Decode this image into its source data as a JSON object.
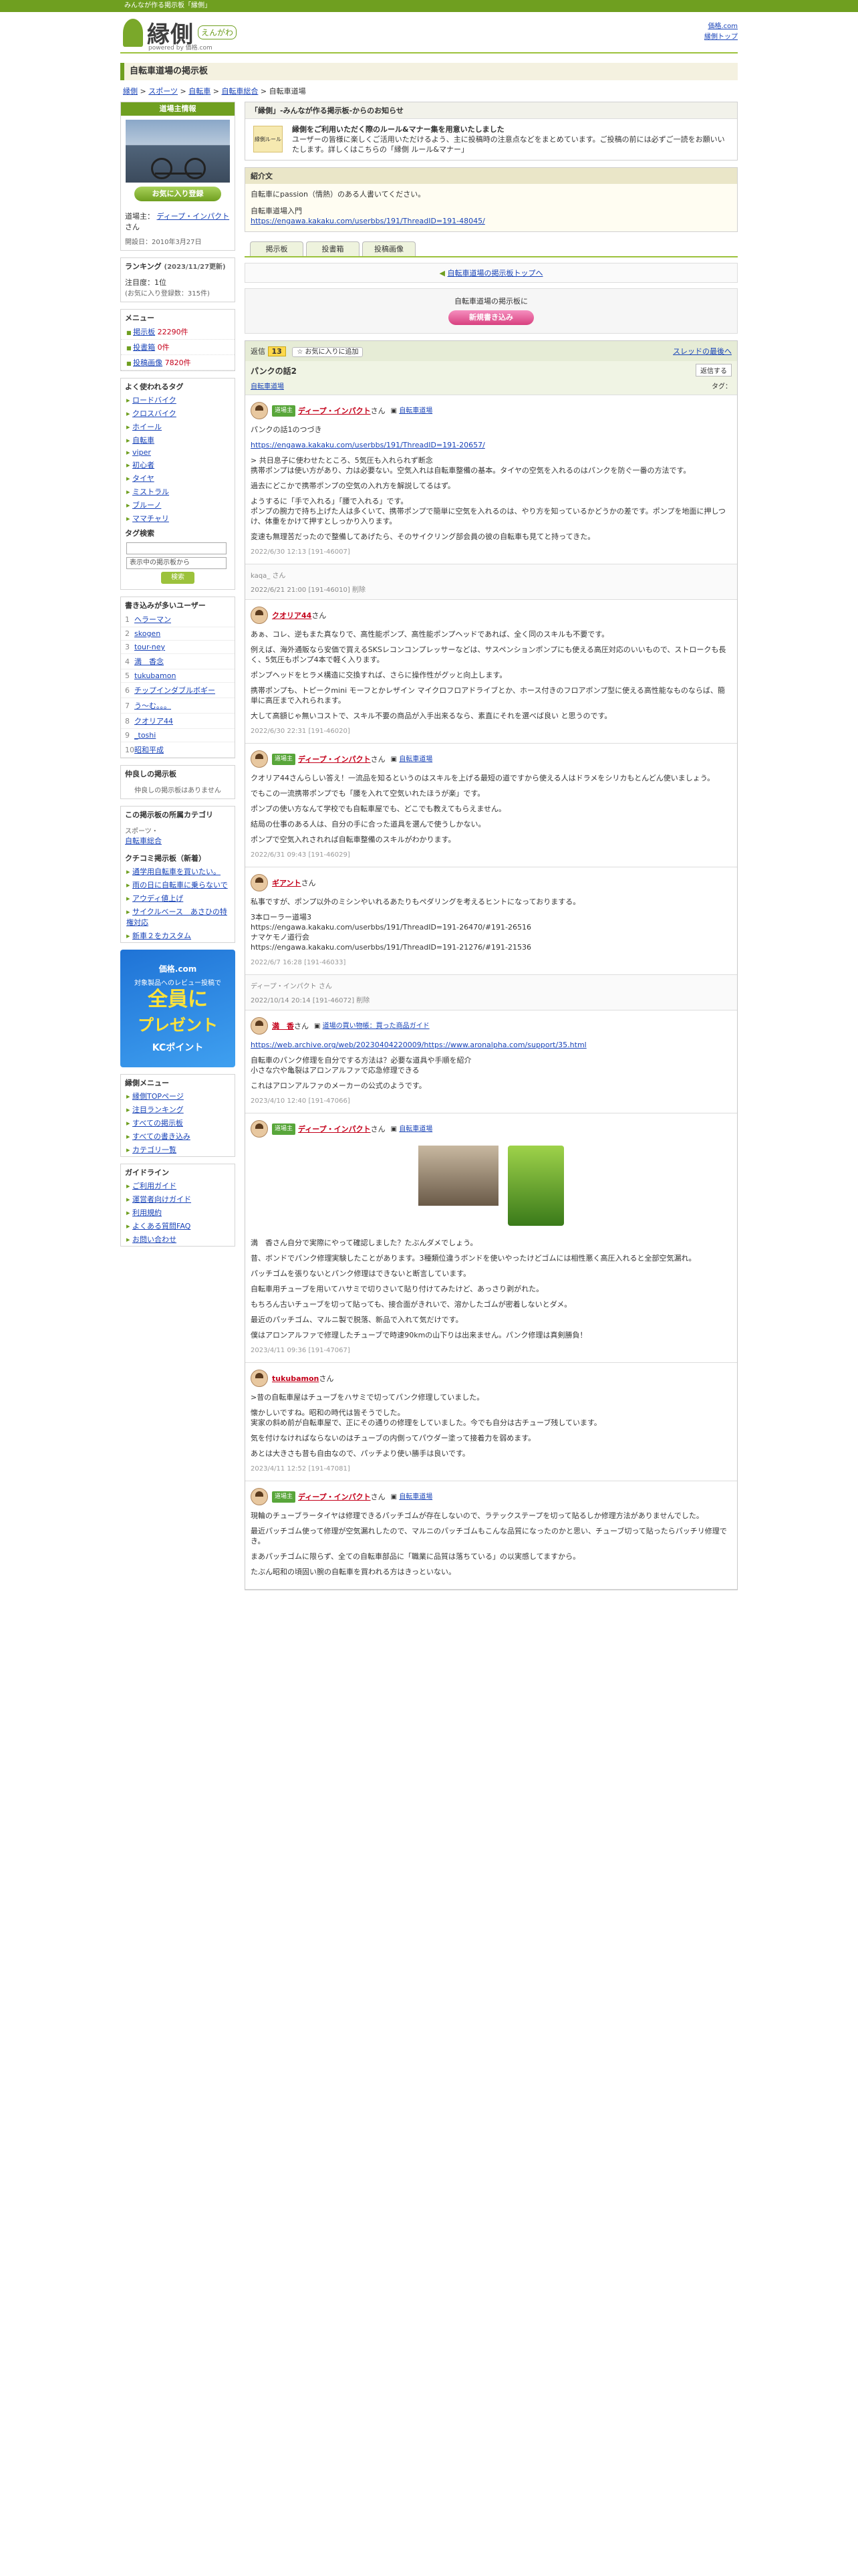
{
  "topbar": {
    "text": "みんなが作る掲示板「縁側」"
  },
  "header": {
    "logo_text": "縁側",
    "logo_reading": "えんがわ",
    "powered_by": "powered by 価格.com",
    "right_links": [
      "価格.com",
      "縁側トップ"
    ]
  },
  "page_title": "自転車道場の掲示板",
  "breadcrumb": [
    "縁側",
    "スポーツ",
    "自転車",
    "自転車総合",
    "自転車道場"
  ],
  "sidebar": {
    "profile_head": "道場主情報",
    "owner_label": "道場主：",
    "owner_name": "ディープ・インパクト",
    "owner_suffix": "さん",
    "fav_button": "お気に入り登録",
    "opened": "開設日：2010年3月27日",
    "ranking_label": "ランキング",
    "ranking_date": "(2023/11/27更新)",
    "popularity": "注目度：1位",
    "popularity_note": "(お気に入り登録数：315件)",
    "menu_head": "メニュー",
    "menu_items": [
      {
        "label": "掲示板",
        "count": "22290件"
      },
      {
        "label": "投書箱",
        "count": "0件"
      },
      {
        "label": "投稿画像",
        "count": "7820件"
      }
    ],
    "tags_head": "よく使われるタグ",
    "tags": [
      "ロードバイク",
      "クロスバイク",
      "ホイール",
      "自転車",
      "viper",
      "初心者",
      "タイヤ",
      "ミストラル",
      "ブルーノ",
      "ママチャリ"
    ],
    "tag_search_head": "タグ検索",
    "tag_select": "表示中の掲示板から",
    "tag_search_button": "検索",
    "writers_head": "書き込みが多いユーザー",
    "writers": [
      "ヘラーマン",
      "skogen",
      "tour-ney",
      "満　香念",
      "tukubamon",
      "チップインダブルボギー",
      "う～む。。。",
      "クオリア44",
      "_toshi",
      "昭和平成"
    ],
    "related_head": "仲良しの掲示板",
    "related_empty": "仲良しの掲示板はありません",
    "category_head": "この掲示板の所属カテゴリ",
    "category_parent": "スポーツ・",
    "category_name": "自転車総合",
    "kuchikomi_head": "クチコミ掲示板（新着）",
    "kuchikomi": [
      "通学用自転車を買いたい。",
      "雨の日に自転車に乗らないで",
      "アウディ値上げ",
      "サイクルベース　あさひの特権対応",
      "新車２をカスタム"
    ],
    "banner": {
      "line1": "価格.com",
      "line2": "対象製品へのレビュー投稿で",
      "big": "全員に",
      "big2": "プレゼント",
      "line3": "KCポイント"
    },
    "engawa_menu_head": "縁側メニュー",
    "engawa_menu": [
      "縁側TOPページ",
      "注目ランキング",
      "すべての掲示板",
      "すべての書き込み",
      "カテゴリ一覧"
    ],
    "guide_head": "ガイドライン",
    "guide": [
      "ご利用ガイド",
      "運営者向けガイド",
      "利用規約",
      "よくある質問FAQ",
      "お問い合わせ"
    ]
  },
  "notice": {
    "head": "「縁側」-みんなが作る掲示板-からのお知らせ",
    "icon": "縁側ルール",
    "bold": "縁側をご利用いただく際のルール&マナー集を用意いたしました",
    "body": "ユーザーの皆様に楽しくご活用いただけるよう、主に投稿時の注意点などをまとめています。ご投稿の前には必ずご一読をお願いいたします。詳しくはこちらの「縁側 ルール&マナー」"
  },
  "intro": {
    "head": "紹介文",
    "line1": "自転車にpassion（情熱）のある人書いてください。",
    "line2": "自転車道場入門",
    "link": "https://engawa.kakaku.com/userbbs/191/ThreadID=191-48045/"
  },
  "tabs": [
    "掲示板",
    "投書箱",
    "投稿画像"
  ],
  "board_top_link": "自転車道場の掲示板トップへ",
  "newpost": {
    "label": "自転車道場の掲示板に",
    "button": "新規書き込み"
  },
  "thread": {
    "count_label": "返信",
    "count": "13",
    "fav": "お気に入りに追加",
    "latest": "スレッドの最後へ",
    "title": "パンクの話2",
    "vote": "返信する",
    "category": "自転車道場",
    "tag_label": "タグ："
  },
  "posts": [
    {
      "badge": "道場主",
      "user": "ディープ・インパクト",
      "suffix": "さん",
      "cat": "自転車道場",
      "paras": [
        "パンクの話1のつづき",
        "https://engawa.kakaku.com/userbbs/191/ThreadID=191-20657/",
        "> 共日息子に使わせたところ、5気圧も入れられず断念\n携帯ポンプは使い方があり、力は必要ない。空気入れは自転車整備の基本。タイヤの空気を入れるのはパンクを防ぐ一番の方法です。",
        "過去にどこかで携帯ポンプの空気の入れ方を解説してるはず。",
        "ようするに「手で入れる」「腰で入れる」です。\nポンプの腕力で持ち上げた人は多くいて、携帯ポンプで簡単に空気を入れるのは、やり方を知っているかどうかの差です。ポンプを地面に押しつけ、体重をかけて押すとしっかり入ります。",
        "変速も無理苦だったので整備してあげたら、そのサイクリング部会員の彼の自転車も見てと持ってきた。"
      ],
      "meta": "2022/6/30 12:13 [191-46007]"
    },
    {
      "anon": "kaqa_ さん",
      "meta": "2022/6/21 21:00 [191-46010] 削除"
    },
    {
      "badge": "",
      "user": "クオリア44",
      "suffix": "さん",
      "cat": "",
      "paras": [
        "あぁ、コレ、逆もまた真なりで、高性能ポンプ、高性能ポンプヘッドであれば、全く同のスキルも不要です。",
        "例えば、海外通販なら安価で買えるSKSレコンコンプレッサーなどは、サスペンションポンプにも使える高圧対応のいいもので、ストロークも長く、5気圧もポンプ4本で軽く入ります。",
        "ポンプヘッドをヒラメ構造に交換すれば、さらに操作性がグッと向上します。",
        "携帯ポンプも、トピークmini モーフとかレザイン マイクロフロアドライブとか、ホース付きのフロアポンプ型に使える高性能なものならば、簡単に高圧まで入れられます。",
        "大して高額じゃ無いコストで、スキル不要の商品が入手出来るなら、素直にそれを選べば良い と思うのです。"
      ],
      "meta": "2022/6/30 22:31 [191-46020]"
    },
    {
      "badge": "道場主",
      "user": "ディープ・インパクト",
      "suffix": "さん",
      "cat": "自転車道場",
      "paras": [
        "クオリア44さんらしい答え！一流品を知るというのはスキルを上げる最短の道ですから使える人はドラメをシリカもとんどん使いましょう。",
        "でもこの一流携帯ポンプでも「腰を入れて空気いれたほうが楽」です。",
        "ポンプの使い方なんて学校でも自転車屋でも、どこでも教えてもらえません。",
        "結局の仕事のある人は、自分の手に合った道具を選んで使うしかない。",
        "ポンプで空気入れされれば自転車整備のスキルがわかります。"
      ],
      "meta": "2022/6/31 09:43 [191-46029]"
    },
    {
      "badge": "",
      "user": "ギアント",
      "suffix": "さん",
      "cat": "",
      "paras": [
        "私事ですが、ポンプ以外のミシンやいれるあたりもペダリングを考えるヒントになっておりまする。",
        "3本ローラー道場3\nhttps://engawa.kakaku.com/userbbs/191/ThreadID=191-26470/#191-26516\nナマケモノ道行会\nhttps://engawa.kakaku.com/userbbs/191/ThreadID=191-21276/#191-21536"
      ],
      "meta": "2022/6/7 16:28 [191-46033]"
    },
    {
      "anon": "ディープ・インパクト さん",
      "meta": "2022/10/14 20:14 [191-46072] 削除"
    },
    {
      "badge": "",
      "user": "満　香",
      "suffix": "さん",
      "cat": "道場の買い物帳：買った商品ガイド",
      "paras": [
        "https://web.archive.org/web/20230404220009/https://www.aronalpha.com/support/35.html",
        "自転車のパンク修理を自分でする方法は？必要な道具や手順を紹介\n小さな穴や亀裂はアロンアルファで応急修理できる",
        "これはアロンアルファのメーカーの公式のようです。"
      ],
      "meta": "2023/4/10 12:40 [191-47066]"
    },
    {
      "badge": "道場主",
      "user": "ディープ・インパクト",
      "suffix": "さん",
      "cat": "自転車道場",
      "images": true,
      "paras": [
        "満　香さん自分で実際にやって確認しました？たぶんダメでしょう。",
        "昔、ボンドでパンク修理実験したことがあります。3種類位違うボンドを使いやったけどゴムには相性悪く高圧入れると全部空気漏れ。",
        "パッチゴムを張りないとパンク修理はできないと断言しています。",
        "自転車用チューブを用いてハサミで切りさいて貼り付けてみたけど、あっさり剥がれた。",
        "もちろん古いチューブを切って貼っても、接合面がきれいで、溶かしたゴムが密着しないとダメ。",
        "最近のパッチゴム、マルニ製で脱落、新品で入れて気だけです。",
        "僕はアロンアルファで修理したチューブで時速90kmの山下りは出来ません。パンク修理は真剣勝負！"
      ],
      "meta": "2023/4/11 09:36 [191-47067]"
    },
    {
      "badge": "",
      "user": "tukubamon",
      "suffix": "さん",
      "cat": "",
      "paras": [
        ">昔の自転車屋はチューブをハサミで切ってパンク修理していました。",
        "懐かしいですね。昭和の時代は皆そうでした。\n実家の斜め前が自転車屋で、正にその通りの修理をしていました。今でも自分は古チューブ残しています。",
        "気を付けなければならないのはチューブの内側ってパウダー塗って接着力を弱めます。",
        "あとは大きさも昔も自由なので、パッチより使い勝手は良いです。"
      ],
      "meta": "2023/4/11 12:52 [191-47081]"
    },
    {
      "badge": "道場主",
      "user": "ディープ・インパクト",
      "suffix": "さん",
      "cat": "自転車道場",
      "paras": [
        "現輪のチューブラータイヤは修理できるパッチゴムが存在しないので、ラテックステープを切って貼るしか修理方法がありませんでした。",
        "最近パッチゴム使って修理が空気漏れしたので、マルニのパッチゴムもこんな品質になったのかと思い、チューブ切って貼ったらパッチリ修理でき。",
        "まあパッチゴムに限らず、全ての自転車部品に「職業に品質は落ちている」の以実感してますから。",
        "たぶん昭和の頃固い腕の自転車を買われる方はきっといない。"
      ],
      "meta": ""
    }
  ]
}
